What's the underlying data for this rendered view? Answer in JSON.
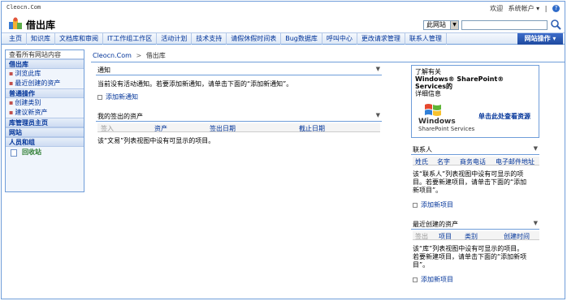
{
  "top": {
    "site_url": "Cleocn.Com",
    "welcome": "欢迎",
    "account": "系统帐户 ▾",
    "separator": "|",
    "help_icon": "help-icon"
  },
  "header": {
    "title": "借出库",
    "scope_value": "此网站",
    "search_placeholder": ""
  },
  "nav": {
    "tabs": [
      "主页",
      "知识库",
      "文档库和审阅",
      "IT工作组工作区",
      "活动计划",
      "技术支持",
      "请假休假时间表",
      "Bug数据库",
      "呼叫中心",
      "更改请求管理",
      "联系人管理"
    ],
    "site_actions": "网站操作 ▾"
  },
  "leftnav": {
    "view_all": "查看所有网站内容",
    "sections": [
      {
        "title": "借出库",
        "items": [
          "浏览此库",
          "最近创建的资产"
        ]
      },
      {
        "title": "普通操作",
        "items": [
          "创建类别",
          "建议新资产"
        ]
      },
      {
        "title": "库管理员主页",
        "items": []
      },
      {
        "title": "网站",
        "items": []
      },
      {
        "title": "人员和组",
        "items": []
      }
    ],
    "recycle": "回收站"
  },
  "breadcrumb": {
    "root": "Cleocn.Com",
    "sep": ">",
    "current": "借出库"
  },
  "announcements": {
    "title": "通知",
    "empty": "当前没有活动通知。若要添加新通知，请单击下面的“添加新通知”。",
    "add": "添加新通知"
  },
  "checked_out": {
    "title": "我的签出的资产",
    "columns": [
      "签入",
      "资产",
      "签出日期",
      "截止日期"
    ],
    "empty": "该“文易”列表视图中设有可显示的项目。"
  },
  "sharepoint": {
    "line1": "了解有关",
    "line2": "Windows® SharePoint® Services的",
    "line3": "详细信息",
    "logo_line1": "Windows",
    "logo_line2": "SharePoint Services",
    "more": "单击此处查看资源"
  },
  "contacts": {
    "title": "联系人",
    "columns": [
      "姓氏",
      "名字",
      "商务电话",
      "电子邮件地址"
    ],
    "empty_l1": "该“联系人”列表视图中设有可显示的项",
    "empty_l2": "目。若要新建项目，请单击下面的“添加",
    "empty_l3": "新项目”。",
    "add": "添加新项目"
  },
  "recent_assets": {
    "title": "最近创建的资产",
    "columns": [
      "签出",
      "项目",
      "类别",
      "创建时间"
    ],
    "empty_l1": "该“库”列表视图中设有可显示的项目。",
    "empty_l2": "若要新建项目，请单击下面的“添加新项",
    "empty_l3": "目”。",
    "add": "添加新项目"
  },
  "colors": {
    "accent": "#6f9dd9",
    "link": "#003399",
    "site_actions": "#1e4aa0"
  }
}
